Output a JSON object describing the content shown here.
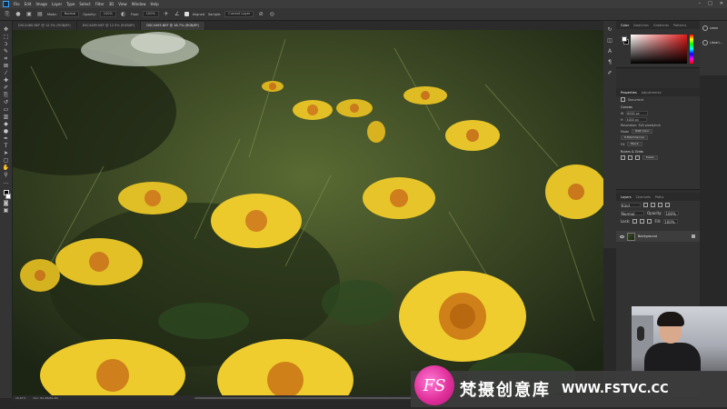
{
  "app": {
    "name": "Ps"
  },
  "menubar": {
    "items": [
      "File",
      "Edit",
      "Image",
      "Layer",
      "Type",
      "Select",
      "Filter",
      "3D",
      "View",
      "Window",
      "Help"
    ],
    "window_controls": [
      "–",
      "□",
      "✕"
    ]
  },
  "options_bar": {
    "mode_label": "Mode:",
    "mode_value": "Normal",
    "opacity_label": "Opacity:",
    "opacity_value": "100%",
    "flow_label": "Flow:",
    "flow_value": "100%",
    "aligned_label": "Aligned",
    "sample_label": "Sample:",
    "sample_value": "Current Layer"
  },
  "tabs": [
    {
      "label": "DSC4480.NEF @ 12.5% (RGB/8*)",
      "active": false
    },
    {
      "label": "DSC4489.NEF @ 12.5% (RGB/8*)",
      "active": false
    },
    {
      "label": "DSC4493.NEF @ 16.7% (RGB/8*)",
      "active": true
    }
  ],
  "status": {
    "zoom": "16.67%",
    "doc_info": "Doc: 84.4M/84.4M"
  },
  "color_panel": {
    "tabs": [
      "Color",
      "Swatches",
      "Gradients",
      "Patterns"
    ]
  },
  "properties_panel": {
    "tabs": [
      "Properties",
      "Adjustments"
    ],
    "document_label": "Document",
    "canvas_label": "Canvas",
    "w_label": "W",
    "w_value": "6000 px",
    "h_label": "H",
    "h_value": "4000 px",
    "resolution": "Resolution: 300 pixels/inch",
    "mode_label": "Mode",
    "mode_value": "RGB Color",
    "bits_value": "8 Bits/Channel",
    "fill_label": "Fill",
    "fill_value": "Black",
    "rulers_label": "Rulers & Grids",
    "unit_value": "Pixels"
  },
  "layers_panel": {
    "tabs": [
      "Layers",
      "Channels",
      "Paths"
    ],
    "kind_label": "Kind",
    "blend_value": "Normal",
    "opacity_label": "Opacity:",
    "opacity_value": "100%",
    "lock_label": "Lock:",
    "fill_label": "Fill:",
    "fill_value": "100%",
    "layer_name": "Background"
  },
  "right_strip": {
    "items": [
      "Learn",
      "Librari..."
    ]
  },
  "watermark": {
    "logo": "FS",
    "cn_text": "梵摄创意库",
    "url": "WWW.FSTVC.CC"
  },
  "colors": {
    "accent": "#31a8ff",
    "watermark_pink": "#e0309a",
    "chrome": "#343434"
  }
}
